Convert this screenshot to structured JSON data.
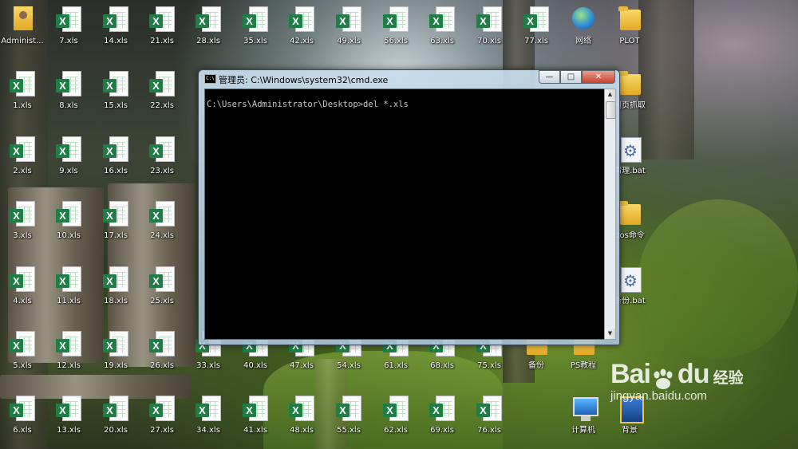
{
  "desktop": {
    "icons": [
      {
        "label": "Administ...",
        "type": "user"
      },
      {
        "label": "7.xls",
        "type": "xls"
      },
      {
        "label": "14.xls",
        "type": "xls"
      },
      {
        "label": "21.xls",
        "type": "xls"
      },
      {
        "label": "28.xls",
        "type": "xls"
      },
      {
        "label": "35.xls",
        "type": "xls"
      },
      {
        "label": "42.xls",
        "type": "xls"
      },
      {
        "label": "49.xls",
        "type": "xls"
      },
      {
        "label": "56.xls",
        "type": "xls"
      },
      {
        "label": "63.xls",
        "type": "xls"
      },
      {
        "label": "70.xls",
        "type": "xls"
      },
      {
        "label": "77.xls",
        "type": "xls"
      },
      {
        "label": "网络",
        "type": "network"
      },
      {
        "label": "PLOT",
        "type": "folder"
      },
      {
        "label": "1.xls",
        "type": "xls"
      },
      {
        "label": "8.xls",
        "type": "xls"
      },
      {
        "label": "15.xls",
        "type": "xls"
      },
      {
        "label": "22.xls",
        "type": "xls"
      },
      {
        "label": "网页抓取",
        "type": "folder"
      },
      {
        "label": "2.xls",
        "type": "xls"
      },
      {
        "label": "9.xls",
        "type": "xls"
      },
      {
        "label": "16.xls",
        "type": "xls"
      },
      {
        "label": "23.xls",
        "type": "xls"
      },
      {
        "label": "清理.bat",
        "type": "bat"
      },
      {
        "label": "3.xls",
        "type": "xls"
      },
      {
        "label": "10.xls",
        "type": "xls"
      },
      {
        "label": "17.xls",
        "type": "xls"
      },
      {
        "label": "24.xls",
        "type": "xls"
      },
      {
        "label": "dos命令",
        "type": "folder"
      },
      {
        "label": "4.xls",
        "type": "xls"
      },
      {
        "label": "11.xls",
        "type": "xls"
      },
      {
        "label": "18.xls",
        "type": "xls"
      },
      {
        "label": "25.xls",
        "type": "xls"
      },
      {
        "label": "备份.bat",
        "type": "bat"
      },
      {
        "label": "5.xls",
        "type": "xls"
      },
      {
        "label": "12.xls",
        "type": "xls"
      },
      {
        "label": "19.xls",
        "type": "xls"
      },
      {
        "label": "26.xls",
        "type": "xls"
      },
      {
        "label": "33.xls",
        "type": "xls"
      },
      {
        "label": "40.xls",
        "type": "xls"
      },
      {
        "label": "47.xls",
        "type": "xls"
      },
      {
        "label": "54.xls",
        "type": "xls"
      },
      {
        "label": "61.xls",
        "type": "xls"
      },
      {
        "label": "68.xls",
        "type": "xls"
      },
      {
        "label": "75.xls",
        "type": "xls"
      },
      {
        "label": "备份",
        "type": "folder"
      },
      {
        "label": "PS教程",
        "type": "folder"
      },
      {
        "label": "6.xls",
        "type": "xls"
      },
      {
        "label": "13.xls",
        "type": "xls"
      },
      {
        "label": "20.xls",
        "type": "xls"
      },
      {
        "label": "27.xls",
        "type": "xls"
      },
      {
        "label": "34.xls",
        "type": "xls"
      },
      {
        "label": "41.xls",
        "type": "xls"
      },
      {
        "label": "48.xls",
        "type": "xls"
      },
      {
        "label": "55.xls",
        "type": "xls"
      },
      {
        "label": "62.xls",
        "type": "xls"
      },
      {
        "label": "69.xls",
        "type": "xls"
      },
      {
        "label": "76.xls",
        "type": "xls"
      },
      {
        "label": "计算机",
        "type": "computer"
      },
      {
        "label": "背景",
        "type": "picture"
      }
    ]
  },
  "cmd_window": {
    "title": "管理员: C:\\Windows\\system32\\cmd.exe",
    "icon_text": "C:\\",
    "minimize": "—",
    "maximize": "□",
    "close": "✕",
    "console_text": "C:\\Users\\Administrator\\Desktop>del *.xls",
    "scroll_up": "▲",
    "scroll_down": "▼"
  },
  "watermark": {
    "brand": "Bai",
    "brand2": "du",
    "sub": "经验",
    "url": "jingyan.baidu.com"
  }
}
